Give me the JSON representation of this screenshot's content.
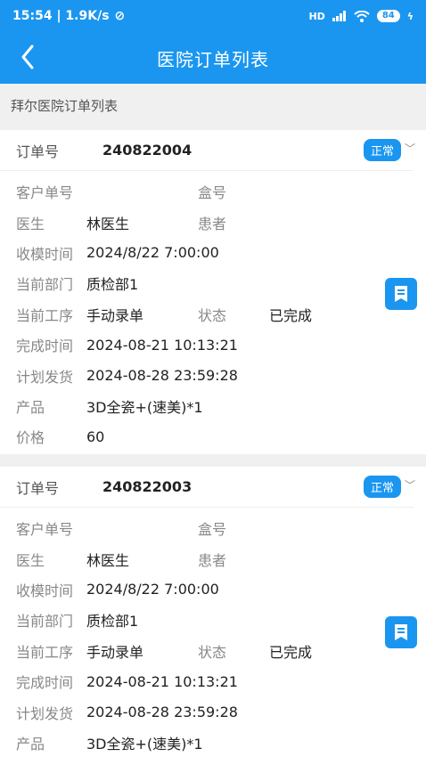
{
  "status_bar": {
    "time_speed": "15:54 | 1.9K/s",
    "network": "HD",
    "battery": "84"
  },
  "nav": {
    "title": "医院订单列表"
  },
  "subheader": "拜尔医院订单列表",
  "labels": {
    "order_no": "订单号",
    "customer_no": "客户单号",
    "box_no": "盒号",
    "doctor": "医生",
    "patient": "患者",
    "receive_time": "收模时间",
    "current_dept": "当前部门",
    "current_process": "当前工序",
    "status": "状态",
    "finish_time": "完成时间",
    "plan_ship": "计划发货",
    "product": "产品",
    "price": "价格"
  },
  "orders": [
    {
      "order_no": "240822004",
      "badge": "正常",
      "customer_no": "",
      "box_no": "",
      "doctor": "林医生",
      "patient": "",
      "receive_time": "2024/8/22 7:00:00",
      "current_dept": "质检部1",
      "current_process": "手动录单",
      "status": "已完成",
      "finish_time": "2024-08-21 10:13:21",
      "plan_ship": "2024-08-28 23:59:28",
      "product": "3D全瓷+(速美)*1",
      "price": "60"
    },
    {
      "order_no": "240822003",
      "badge": "正常",
      "customer_no": "",
      "box_no": "",
      "doctor": "林医生",
      "patient": "",
      "receive_time": "2024/8/22 7:00:00",
      "current_dept": "质检部1",
      "current_process": "手动录单",
      "status": "已完成",
      "finish_time": "2024-08-21 10:13:21",
      "plan_ship": "2024-08-28 23:59:28",
      "product": "3D全瓷+(速美)*1"
    }
  ],
  "colors": {
    "primary": "#1a96f0",
    "background": "#f0f0f0"
  }
}
